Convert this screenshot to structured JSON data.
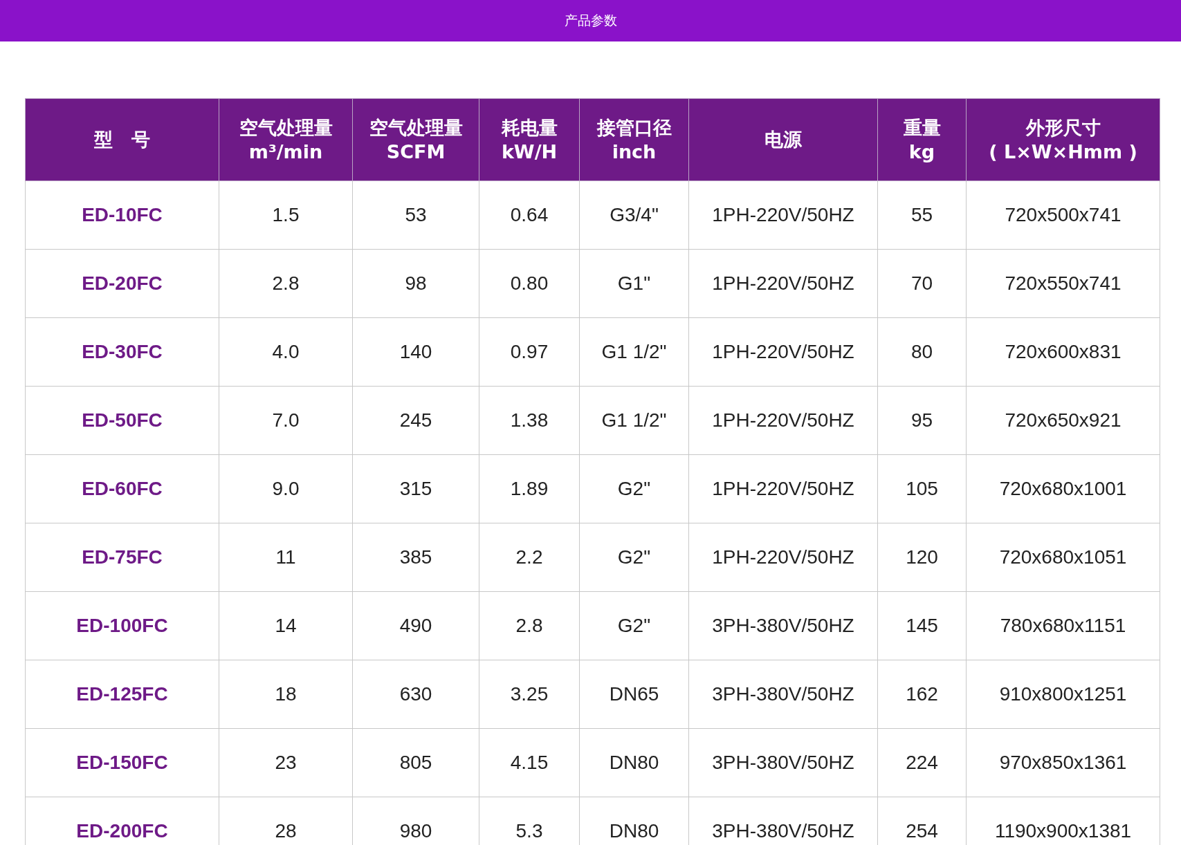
{
  "top_bar": {
    "title": "产品参数"
  },
  "table": {
    "columns": [
      "型　号",
      "空气处理量\nm³/min",
      "空气处理量\nSCFM",
      "耗电量\nkW/H",
      "接管口径\ninch",
      "电源",
      "重量\nkg",
      "外形尺寸\n( L×W×Hmm )"
    ],
    "rows": [
      [
        "ED-10FC",
        "1.5",
        "53",
        "0.64",
        "G3/4\"",
        "1PH-220V/50HZ",
        "55",
        "720x500x741"
      ],
      [
        "ED-20FC",
        "2.8",
        "98",
        "0.80",
        "G1\"",
        "1PH-220V/50HZ",
        "70",
        "720x550x741"
      ],
      [
        "ED-30FC",
        "4.0",
        "140",
        "0.97",
        "G1 1/2\"",
        "1PH-220V/50HZ",
        "80",
        "720x600x831"
      ],
      [
        "ED-50FC",
        "7.0",
        "245",
        "1.38",
        "G1 1/2\"",
        "1PH-220V/50HZ",
        "95",
        "720x650x921"
      ],
      [
        "ED-60FC",
        "9.0",
        "315",
        "1.89",
        "G2\"",
        "1PH-220V/50HZ",
        "105",
        "720x680x1001"
      ],
      [
        "ED-75FC",
        "11",
        "385",
        "2.2",
        "G2\"",
        "1PH-220V/50HZ",
        "120",
        "720x680x1051"
      ],
      [
        "ED-100FC",
        "14",
        "490",
        "2.8",
        "G2\"",
        "3PH-380V/50HZ",
        "145",
        "780x680x1151"
      ],
      [
        "ED-125FC",
        "18",
        "630",
        "3.25",
        "DN65",
        "3PH-380V/50HZ",
        "162",
        "910x800x1251"
      ],
      [
        "ED-150FC",
        "23",
        "805",
        "4.15",
        "DN80",
        "3PH-380V/50HZ",
        "224",
        "970x850x1361"
      ],
      [
        "ED-200FC",
        "28",
        "980",
        "5.3",
        "DN80",
        "3PH-380V/50HZ",
        "254",
        "1190x900x1381"
      ]
    ]
  }
}
